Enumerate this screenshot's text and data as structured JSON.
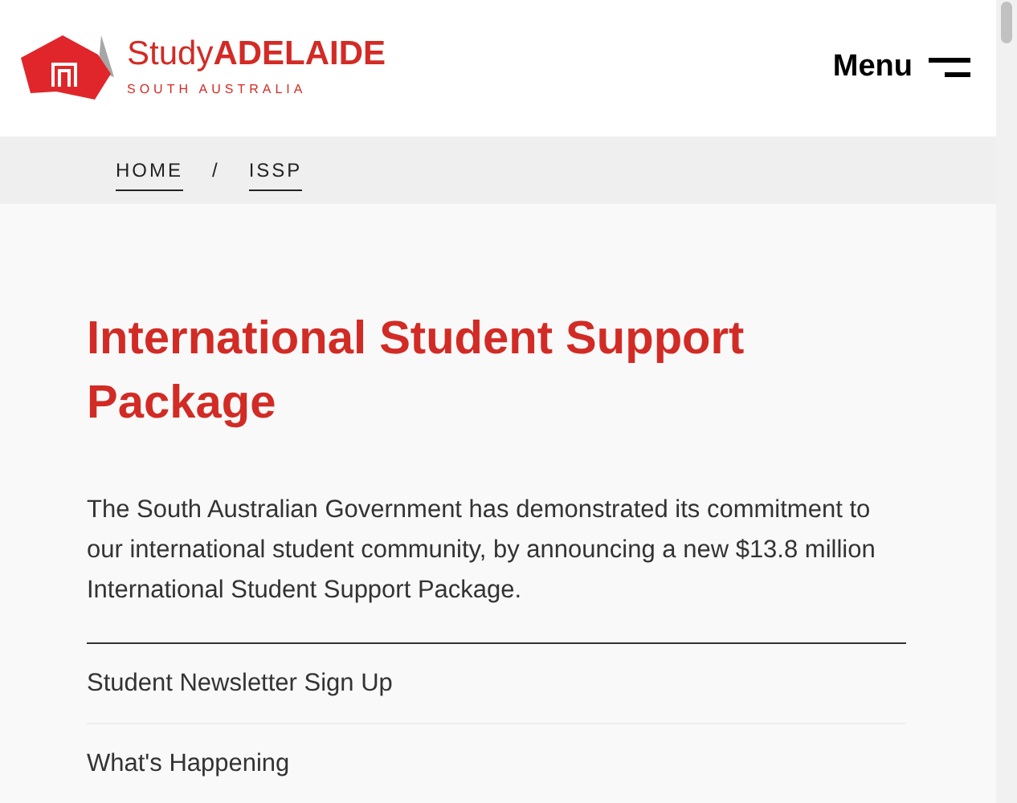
{
  "header": {
    "logo": {
      "name": "Study**ADELAIDE**",
      "tagline": "SOUTH AUSTRALIA"
    },
    "menu_button": "Menu"
  },
  "breadcrumbs": [
    {
      "label": "HOME"
    },
    {
      "label": "ISSP"
    }
  ],
  "breadcrumb_separator": "/",
  "title": "International Student Support Package",
  "intro": "The South Australian Government has demonstrated its commitment to our international student community, by announcing a new $13.8 million International Student Support Package.",
  "links": [
    {
      "label": "Student Newsletter Sign Up"
    },
    {
      "label": "What's Happening"
    }
  ]
}
